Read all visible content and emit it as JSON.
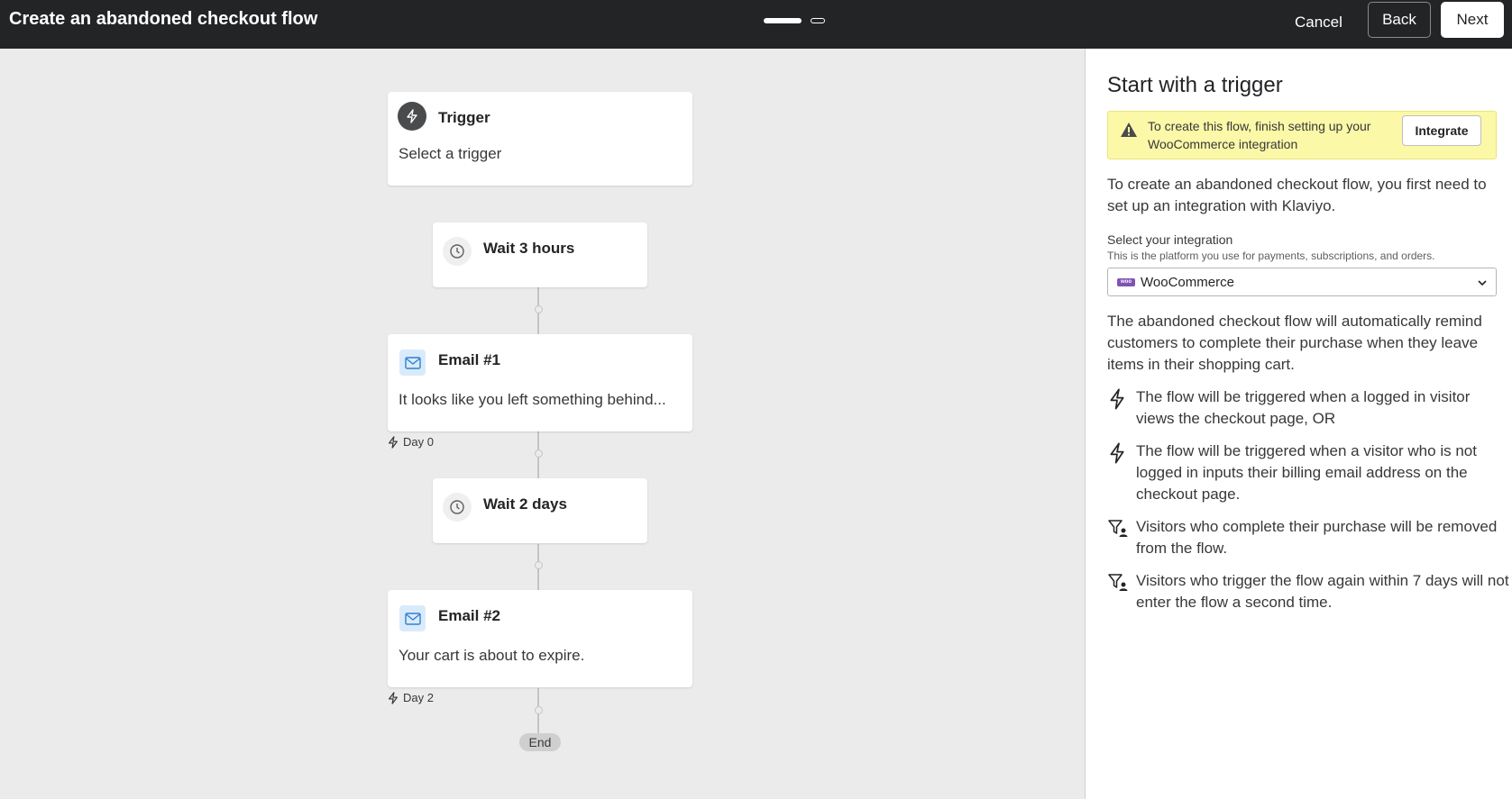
{
  "header": {
    "title": "Create an abandoned checkout flow",
    "cancel_label": "Cancel",
    "back_label": "Back",
    "next_label": "Next",
    "progress": {
      "current_step": 1,
      "total_steps": 2
    }
  },
  "flow": {
    "trigger": {
      "heading": "Trigger",
      "body": "Select a trigger"
    },
    "wait1": {
      "label": "Wait 3 hours"
    },
    "email1": {
      "heading": "Email #1",
      "body": "It looks like you left something behind...",
      "day": "Day 0"
    },
    "wait2": {
      "label": "Wait 2 days"
    },
    "email2": {
      "heading": "Email #2",
      "body": "Your cart is about to expire.",
      "day": "Day 2"
    },
    "end_label": "End"
  },
  "panel": {
    "title": "Start with a trigger",
    "alert": {
      "text": "To create this flow, finish setting up your WooCommerce integration",
      "button_label": "Integrate"
    },
    "intro": "To create an abandoned checkout flow, you first need to set up an integration with Klaviyo.",
    "integration": {
      "label": "Select your integration",
      "help": "This is the platform you use for payments, subscriptions, and orders.",
      "selected": "WooCommerce",
      "logo_text": "woo"
    },
    "description": "The abandoned checkout flow will automatically remind customers to complete their purchase when they leave items in their shopping cart.",
    "bullets": [
      {
        "icon": "lightning-icon",
        "text": "The flow will be triggered when a logged in visitor views the checkout page, OR"
      },
      {
        "icon": "lightning-icon",
        "text": "The flow will be triggered when a visitor who is not logged in inputs their billing email address on the checkout page."
      },
      {
        "icon": "filter-person-icon",
        "text": "Visitors who complete their purchase will be removed from the flow."
      },
      {
        "icon": "filter-person-icon",
        "text": "Visitors who trigger the flow again within 7 days will not enter the flow a second time."
      }
    ]
  },
  "colors": {
    "topbar": "#232426",
    "canvas": "#ebebeb",
    "alert_bg": "#fbf8a8",
    "mail_icon": "#2f7fd1",
    "woo_purple": "#7f54b3"
  }
}
